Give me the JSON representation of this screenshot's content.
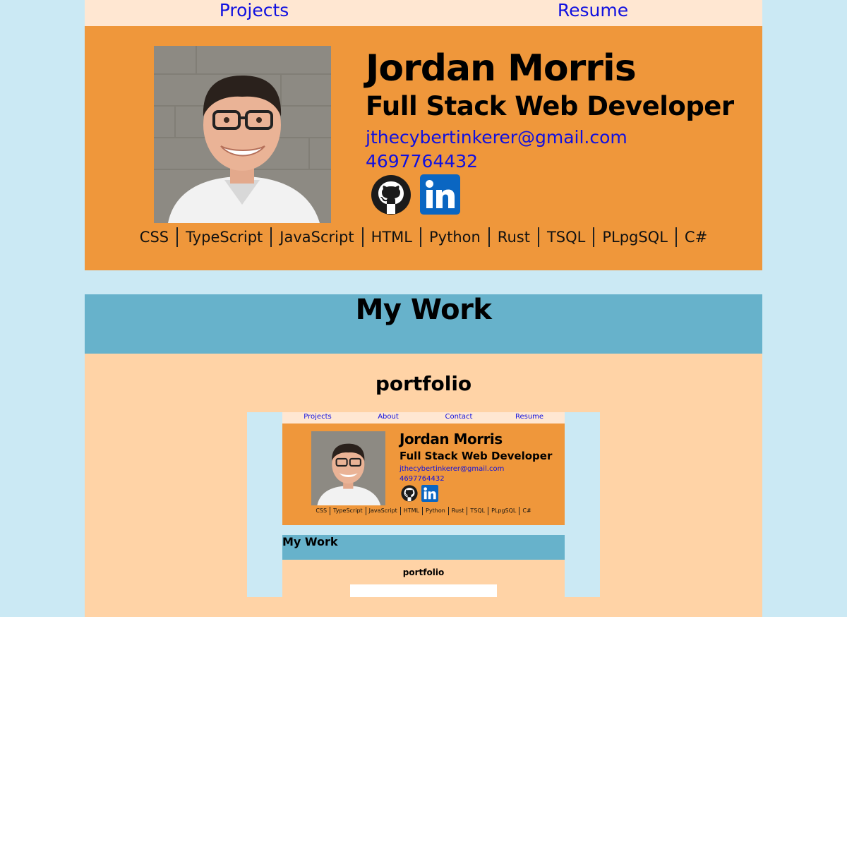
{
  "nav": {
    "projects": "Projects",
    "resume": "Resume"
  },
  "profile": {
    "name": "Jordan Morris",
    "title": "Full Stack Web Developer",
    "email": "jthecybertinkerer@gmail.com",
    "phone": "4697764432"
  },
  "skills": [
    "CSS",
    "TypeScript",
    "JavaScript",
    "HTML",
    "Python",
    "Rust",
    "TSQL",
    "PLpgSQL",
    "C#"
  ],
  "my_work": {
    "heading": "My Work",
    "project_title": "portfolio"
  },
  "preview": {
    "nav": [
      "Projects",
      "About",
      "Contact",
      "Resume"
    ],
    "name": "Jordan Morris",
    "title": "Full Stack Web Developer",
    "email": "jthecybertinkerer@gmail.com",
    "phone": "4697764432",
    "skills": [
      "CSS",
      "TypeScript",
      "JavaScript",
      "HTML",
      "Python",
      "Rust",
      "TSQL",
      "PLpgSQL",
      "C#"
    ],
    "heading": "My Work",
    "project_title": "portfolio"
  },
  "icons": {
    "github": "github-icon",
    "linkedin": "linkedin-icon"
  },
  "colors": {
    "page_bg": "#cbe9f4",
    "nav_bg": "#ffe7d2",
    "hero_bg": "#ef973b",
    "section_header_bg": "#67b2cb",
    "section_body_bg": "#ffd3a6",
    "link": "#1010e0",
    "linkedin_blue": "#0a66c2"
  }
}
